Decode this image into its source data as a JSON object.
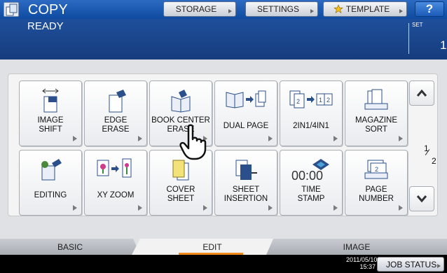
{
  "header": {
    "title": "COPY",
    "buttons": [
      {
        "label": "STORAGE"
      },
      {
        "label": "SETTINGS"
      },
      {
        "label": "TEMPLATE"
      }
    ],
    "help_label": "?"
  },
  "status": {
    "text": "READY",
    "set_label": "SET",
    "set_value": "1"
  },
  "functions": [
    {
      "label": "IMAGE\nSHIFT",
      "icon": "image-shift-icon"
    },
    {
      "label": "EDGE\nERASE",
      "icon": "edge-erase-icon"
    },
    {
      "label": "BOOK CENTER\nERASE",
      "icon": "book-center-erase-icon"
    },
    {
      "label": "DUAL PAGE",
      "icon": "dual-page-icon"
    },
    {
      "label": "2IN1/4IN1",
      "icon": "2in1-4in1-icon"
    },
    {
      "label": "MAGAZINE\nSORT",
      "icon": "magazine-sort-icon"
    },
    {
      "label": "EDITING",
      "icon": "editing-icon"
    },
    {
      "label": "XY ZOOM",
      "icon": "xy-zoom-icon"
    },
    {
      "label": "COVER\nSHEET",
      "icon": "cover-sheet-icon"
    },
    {
      "label": "SHEET\nINSERTION",
      "icon": "sheet-insertion-icon"
    },
    {
      "label": "TIME\nSTAMP",
      "icon": "time-stamp-icon",
      "icon_text": "00:00"
    },
    {
      "label": "PAGE\nNUMBER",
      "icon": "page-number-icon"
    }
  ],
  "pagination": {
    "current": "1",
    "total": "2"
  },
  "tabs": [
    {
      "label": "BASIC"
    },
    {
      "label": "EDIT",
      "active": true
    },
    {
      "label": "IMAGE"
    }
  ],
  "footer": {
    "date": "2011/05/10",
    "time": "15:37",
    "job_status_label": "JOB STATUS"
  },
  "colors": {
    "accent": "#f08a1d",
    "header_blue": "#1f4f9c"
  }
}
